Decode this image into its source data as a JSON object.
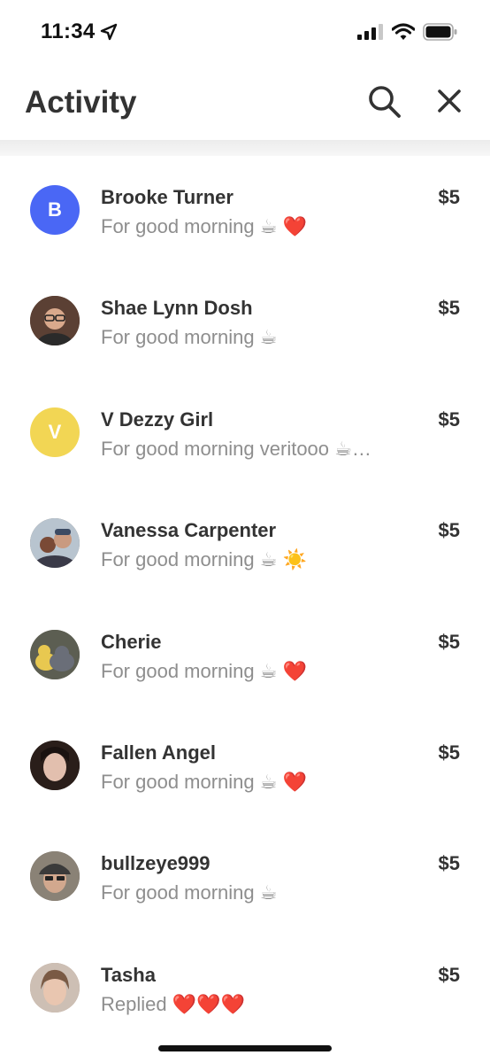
{
  "status_bar": {
    "time": "11:34"
  },
  "header": {
    "title": "Activity"
  },
  "activity": [
    {
      "name": "Brooke Turner",
      "note": "For good morning ☕ ❤️",
      "amount": "$5",
      "avatar_letter": "B",
      "avatar_color": "#4a67f5"
    },
    {
      "name": "Shae Lynn Dosh",
      "note": "For good morning ☕",
      "amount": "$5",
      "avatar_letter": "",
      "avatar_color": "#6b4a3a"
    },
    {
      "name": "V Dezzy Girl",
      "note": "For good morning veritooo ☕…",
      "amount": "$5",
      "avatar_letter": "V",
      "avatar_color": "#f2d654"
    },
    {
      "name": "Vanessa Carpenter",
      "note": "For good morning ☕ ☀️",
      "amount": "$5",
      "avatar_letter": "",
      "avatar_color": "#8a7a6a"
    },
    {
      "name": "Cherie",
      "note": "For good morning ☕ ❤️",
      "amount": "$5",
      "avatar_letter": "",
      "avatar_color": "#6e6a58"
    },
    {
      "name": "Fallen Angel",
      "note": "For good morning ☕ ❤️",
      "amount": "$5",
      "avatar_letter": "",
      "avatar_color": "#3a2a24"
    },
    {
      "name": "bullzeye999",
      "note": "For good morning ☕",
      "amount": "$5",
      "avatar_letter": "",
      "avatar_color": "#7a7068"
    },
    {
      "name": "Tasha",
      "note": "Replied ❤️❤️❤️",
      "amount": "$5",
      "avatar_letter": "",
      "avatar_color": "#b59a88"
    }
  ]
}
